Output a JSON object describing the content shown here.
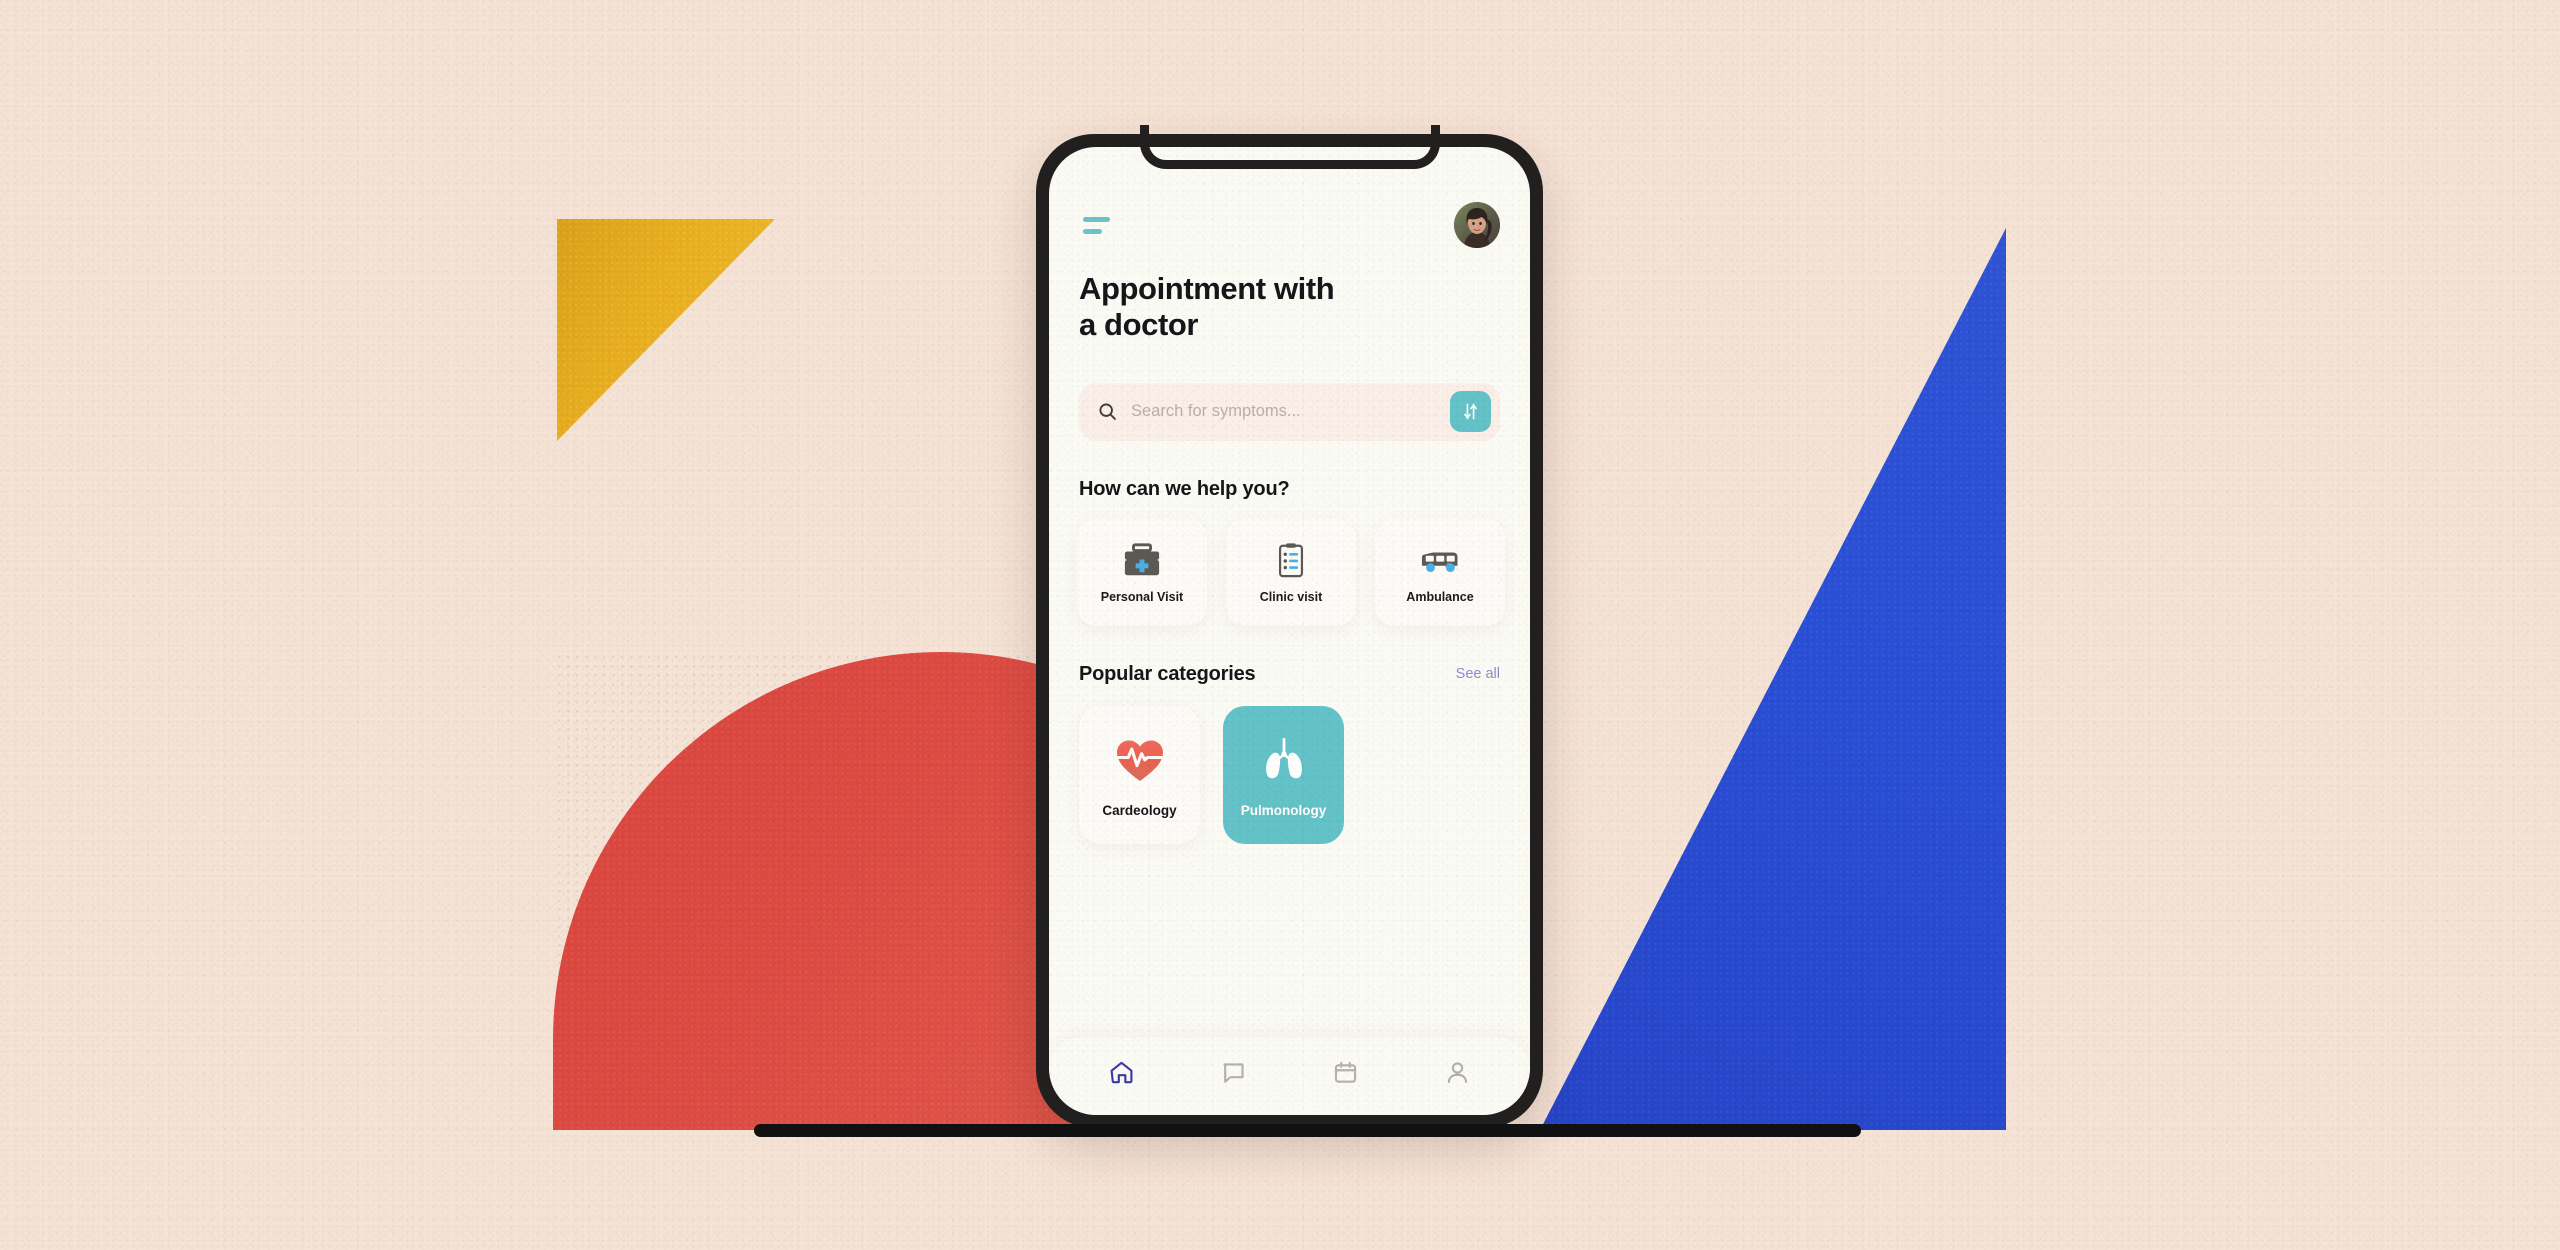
{
  "poster": {
    "background_color": "#F5E3D6",
    "shapes": [
      {
        "name": "yellow-triangle",
        "color": "#E8AE22"
      },
      {
        "name": "red-dome",
        "color": "#DC4A42"
      },
      {
        "name": "blue-triangle",
        "color": "#2A4FD6"
      },
      {
        "name": "ground-bar",
        "color": "#111111"
      }
    ]
  },
  "app": {
    "header": {
      "menu_icon": "hamburger-menu-icon",
      "avatar_icon": "user-avatar-photo",
      "accent_color": "#6CC4CB"
    },
    "title": "Appointment with\na doctor",
    "search": {
      "icon": "search-icon",
      "value": "",
      "placeholder": "Search for symptoms...",
      "filter_icon": "sliders-filter-icon",
      "filter_color": "#63C3C8"
    },
    "help_section": {
      "title": "How can we help you?",
      "services": [
        {
          "label": "Personal Visit",
          "icon": "medical-kit-icon"
        },
        {
          "label": "Clinic visit",
          "icon": "clipboard-checklist-icon"
        },
        {
          "label": "Ambulance",
          "icon": "ambulance-van-icon"
        }
      ]
    },
    "categories_section": {
      "title": "Popular categories",
      "see_all_label": "See all",
      "see_all_color": "#8B8CD3",
      "categories": [
        {
          "label": "Cardeology",
          "icon": "heart-pulse-icon",
          "selected": false,
          "color": "#FDFBF8"
        },
        {
          "label": "Pulmonology",
          "icon": "lungs-icon",
          "selected": true,
          "color": "#63C3C8"
        }
      ]
    },
    "bottom_nav": [
      {
        "icon": "home-icon",
        "active": true
      },
      {
        "icon": "chat-bubble-icon",
        "active": false
      },
      {
        "icon": "calendar-icon",
        "active": false
      },
      {
        "icon": "person-icon",
        "active": false
      }
    ]
  }
}
